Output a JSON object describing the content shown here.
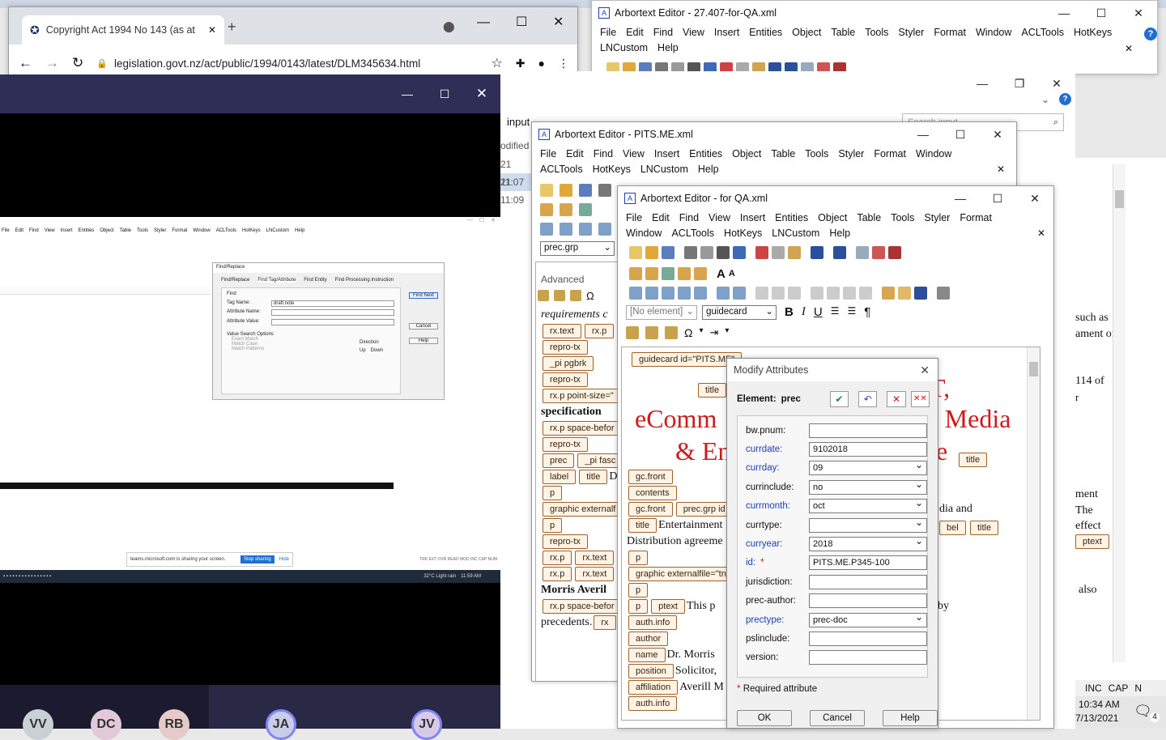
{
  "browser": {
    "tab_title": "Copyright Act 1994 No 143 (as at",
    "url": "legislation.govt.nz/act/public/1994/0143/latest/DLM345634.html"
  },
  "editor_main": {
    "title": "Arbortext Editor - 27.407-for-QA.xml",
    "menu": [
      "File",
      "Edit",
      "Find",
      "View",
      "Insert",
      "Entities",
      "Object",
      "Table",
      "Tools",
      "Styler",
      "Format",
      "Window",
      "ACLTools",
      "HotKeys",
      "LNCustom",
      "Help"
    ]
  },
  "bg_window": {
    "input_label": "input",
    "side_texts": [
      "odified",
      "21 11:07",
      "21 11:09"
    ],
    "search_placeholder": "Search input",
    "right_texts": [
      "such as",
      "ament of",
      "114 of",
      "r",
      "ment",
      "The",
      "effect",
      "ptext",
      "also"
    ],
    "status": [
      "INC",
      "CAP",
      "N"
    ],
    "clock_time": "10:34 AM",
    "clock_date": "7/13/2021",
    "notif_count": "4"
  },
  "editor_pits": {
    "title": "Arbortext Editor - PITS.ME.xml",
    "menu": [
      "File",
      "Edit",
      "Find",
      "View",
      "Insert",
      "Entities",
      "Object",
      "Table",
      "Tools",
      "Styler",
      "Format",
      "Window",
      "ACLTools",
      "HotKeys",
      "LNCustom",
      "Help"
    ],
    "element_box": "prec.grp",
    "panel_label": "Advanced",
    "doc_lines": [
      {
        "text": "requirements c",
        "style": "italic"
      },
      {
        "tags": [
          "rx.text",
          "rx.p"
        ]
      },
      {
        "tags": [
          "repro-tx"
        ]
      },
      {
        "tags": [
          "_pi pgbrk"
        ]
      },
      {
        "tags": [
          "repro-tx"
        ]
      },
      {
        "tags": [
          "rx.p point-size=\""
        ]
      },
      {
        "text": "specification",
        "style": "bold"
      },
      {
        "tags": [
          "rx.p space-befor"
        ]
      },
      {
        "tags": [
          "repro-tx"
        ]
      },
      {
        "tags": [
          "prec",
          "_pi fasc"
        ]
      },
      {
        "tags": [
          "label",
          "title"
        ],
        "text": "D"
      },
      {
        "tags": [
          "p"
        ]
      },
      {
        "tags": [
          "graphic externalf"
        ]
      },
      {
        "tags": [
          "p"
        ]
      },
      {
        "tags": [
          "repro-tx"
        ]
      },
      {
        "tags": [
          "rx.p",
          "rx.text"
        ]
      },
      {
        "tags": [
          "rx.p",
          "rx.text"
        ]
      },
      {
        "text": "Morris Averil",
        "style": "bold"
      },
      {
        "tags": [
          "rx.p space-befor"
        ]
      },
      {
        "text": "precedents.",
        "style": "normal",
        "tags": [
          "rx"
        ]
      }
    ]
  },
  "editor_qa": {
    "title": "Arbortext Editor - for QA.xml",
    "menu": [
      "File",
      "Edit",
      "Find",
      "View",
      "Insert",
      "Entities",
      "Object",
      "Table",
      "Tools",
      "Styler",
      "Format",
      "Window",
      "ACLTools",
      "HotKeys",
      "LNCustom",
      "Help"
    ],
    "element_combo": "[No element]",
    "style_combo": "guidecard",
    "guidecard_tag": "guidecard id=\"PITS.ME\"",
    "red_lines": [
      "T,",
      "eComm",
      "- Media",
      "& En",
      "e"
    ],
    "doc_lines": [
      {
        "tags": [
          "gc.front"
        ]
      },
      {
        "tags": [
          "contents"
        ]
      },
      {
        "tags": [
          "gc.front",
          "prec.grp id"
        ]
      },
      {
        "text": "Entertainment",
        "tags": [
          "title"
        ]
      },
      {
        "text": "Distribution agreeme"
      },
      {
        "tags": [
          "p"
        ]
      },
      {
        "tags": [
          "graphic externalfile=\"tru"
        ]
      },
      {
        "tags": [
          "p"
        ]
      },
      {
        "tags": [
          "p",
          "ptext"
        ],
        "text": "This p"
      },
      {
        "tags": [
          "auth.info"
        ]
      },
      {
        "tags": [
          "author"
        ]
      },
      {
        "tags": [
          "name"
        ],
        "text": "Dr. Morris"
      },
      {
        "tags": [
          "position"
        ],
        "text": "Solicitor,"
      },
      {
        "tags": [
          "affiliation"
        ],
        "text": "Averill M"
      },
      {
        "tags": [
          "auth.info"
        ]
      }
    ],
    "right_bits": [
      "dia and",
      "title",
      "bel",
      "title",
      "by"
    ]
  },
  "modify_dialog": {
    "title": "Modify Attributes",
    "element_label": "Element:",
    "element_value": "prec",
    "fields": [
      {
        "label": "bw.pnum:",
        "value": "",
        "type": "text",
        "color": "black"
      },
      {
        "label": "currdate:",
        "value": "9102018",
        "type": "text",
        "color": "blue"
      },
      {
        "label": "currday:",
        "value": "09",
        "type": "select",
        "color": "blue"
      },
      {
        "label": "currinclude:",
        "value": "no",
        "type": "select",
        "color": "black"
      },
      {
        "label": "currmonth:",
        "value": "oct",
        "type": "select",
        "color": "blue"
      },
      {
        "label": "currtype:",
        "value": "",
        "type": "select",
        "color": "black"
      },
      {
        "label": "curryear:",
        "value": "2018",
        "type": "select",
        "color": "blue"
      },
      {
        "label": "id:",
        "value": "PITS.ME.P345-100",
        "type": "text",
        "color": "blue",
        "required": "*"
      },
      {
        "label": "jurisdiction:",
        "value": "",
        "type": "text",
        "color": "black"
      },
      {
        "label": "prec-author:",
        "value": "",
        "type": "text",
        "color": "black"
      },
      {
        "label": "prectype:",
        "value": "prec-doc",
        "type": "select",
        "color": "blue"
      },
      {
        "label": "pslinclude:",
        "value": "",
        "type": "text",
        "color": "black"
      },
      {
        "label": "version:",
        "value": "",
        "type": "text",
        "color": "black"
      }
    ],
    "required_star": "*",
    "required_note": "Required attribute",
    "ok": "OK",
    "cancel": "Cancel",
    "help": "Help"
  },
  "teams": {
    "share_text": "teams.microsoft.com is sharing your screen.",
    "stop": "Stop sharing",
    "hide": "Hide",
    "avatars": [
      "VV",
      "DC",
      "RB",
      "JA",
      "JV"
    ],
    "inner_menu": [
      "File",
      "Edit",
      "Find",
      "View",
      "Insert",
      "Entities",
      "Object",
      "Table",
      "Tools",
      "Styler",
      "Format",
      "Window",
      "ACLTools",
      "HotKeys",
      "LNCustom",
      "Help"
    ],
    "find_dialog": {
      "title": "Find/Replace",
      "tabs": [
        "Find/Replace",
        "Find Tag/Attribute",
        "Find Entity",
        "Find Processing Instruction"
      ],
      "group": "Find",
      "tag_name_label": "Tag Name:",
      "tag_name_value": "draft.note",
      "attr_name_label": "Attribute Name:",
      "attr_value_label": "Attribute Value:",
      "options_label": "Value Search Options",
      "options": [
        "Exact Match",
        "Match Case",
        "Match Patterns"
      ],
      "direction_label": "Direction",
      "up": "Up",
      "down": "Down",
      "buttons": [
        "Find Next",
        "Cancel",
        "Help"
      ]
    },
    "inner_status": "TRK EXT OVR READ MOD INC CAP NUM",
    "weather": "32°C Light rain",
    "inner_time": "11:59 AM"
  }
}
